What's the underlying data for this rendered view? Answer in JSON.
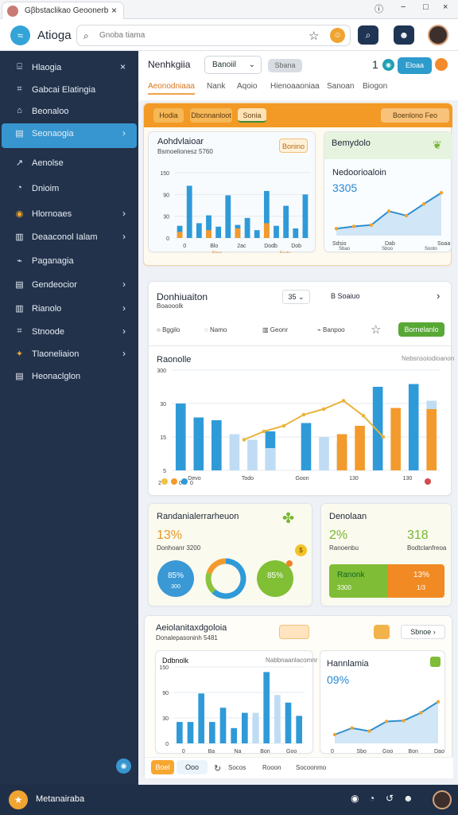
{
  "browser": {
    "tab_title": "Gβbstaclikao Geoonerb",
    "tab_close": "×",
    "controls": [
      "ⓘ",
      "−",
      "□",
      "×"
    ]
  },
  "app": {
    "title": "Atioga",
    "search_placeholder": "Gnoba tiama",
    "right_icons": {
      "star": "☆",
      "profile": "☻",
      "search": "⌕",
      "emoji": "☺"
    }
  },
  "sidebar": {
    "items": [
      {
        "icon": "⌸",
        "label": "Hlaogia",
        "chevron": "×"
      },
      {
        "icon": "⌗",
        "label": "Gabcai Elatingia",
        "chevron": ""
      },
      {
        "icon": "⌂",
        "label": "Beonaloo",
        "chevron": ""
      },
      {
        "icon": "▤",
        "label": "Seonaogia",
        "chevron": "›",
        "active": true
      },
      {
        "icon": "↗",
        "label": "Aenolse",
        "chevron": ""
      },
      {
        "icon": "◔",
        "label": "Dnioim",
        "chevron": ""
      },
      {
        "icon": "◉",
        "label": "Hlornoaes",
        "chevron": "›"
      },
      {
        "icon": "▥",
        "label": "Deaaconol Ialam",
        "chevron": "›"
      },
      {
        "icon": "⌁",
        "label": "Paganagia",
        "chevron": ""
      },
      {
        "icon": "▤",
        "label": "Gendeocior",
        "chevron": "›"
      },
      {
        "icon": "▥",
        "label": "Rianolo",
        "chevron": "›"
      },
      {
        "icon": "⌗",
        "label": "Stnoode",
        "chevron": "›"
      },
      {
        "icon": "✦",
        "label": "Tlaoneliaion",
        "chevron": "›"
      },
      {
        "icon": "▤",
        "label": "Heonaclglon",
        "chevron": ""
      }
    ],
    "footer_fab": "◉"
  },
  "header": {
    "title": "Nenhkgiia",
    "select": "Banoiil",
    "btn_muted": "Sbana",
    "number": "1",
    "btn_primary": "Eloaa",
    "tabs": [
      "Aeonodniaaa",
      "Nank",
      "Aqoio",
      "Hienoaaoniaa",
      "Sanoan",
      "Biogon"
    ]
  },
  "filter_row": {
    "items": [
      "Hodia",
      "Dbcnnanloot",
      "Sonia"
    ],
    "action": "Boenlono Feo"
  },
  "panel1": {
    "title": "Aohdvlaioar",
    "subtitle": "Bsmoelionesz 5760",
    "badge": "Bonino",
    "ytick": [
      "150",
      "90",
      "30",
      "0"
    ],
    "xticks": [
      "0",
      "Blo",
      "2ac",
      "Dodb",
      "Dob"
    ],
    "xsub": [
      "Emo",
      "Eode"
    ]
  },
  "panel2": {
    "title": "Bemydolo",
    "subtitle": "Nedoorioaloin",
    "value": "3305",
    "xticks": [
      "Sdsio",
      "Dab",
      "Soaa"
    ],
    "xsub": [
      "Sbao",
      "Sboo",
      "Sooto"
    ]
  },
  "section": {
    "title": "Donhiuaiton",
    "subtitle": "Boaooolk",
    "select": "35",
    "aside": "Soaiuo",
    "arrow": "›",
    "actions": [
      "Bggilo",
      "Namo",
      "Geonr",
      "Banpoo"
    ],
    "button": "Bornelanlo"
  },
  "chart_main": {
    "title": "Raonolle",
    "right": "Nebsnsoiodioanon",
    "yticks": [
      "300",
      "30",
      "15",
      "5"
    ],
    "xticks": [
      "Devo",
      "Todo",
      "Goon",
      "130",
      "130"
    ],
    "footer": [
      "2",
      "0",
      "0"
    ]
  },
  "summary_left": {
    "title": "Randanialerrarheuon",
    "stat": "13%",
    "stat_label": "Donhoanr 3200",
    "rings": [
      "85%",
      "85%"
    ],
    "ring_labels": [
      "300",
      ""
    ]
  },
  "summary_right": {
    "title": "Denolaan",
    "stat1": "2%",
    "stat2": "318",
    "label1": "Ranoenbu",
    "label2": "Bodtclanfreoa",
    "bar_left": "Ranonk",
    "bar_left_sub": "3300",
    "bar_right": "13%",
    "bar_right_sub": "1/3"
  },
  "bottom_card": {
    "title": "Aeiolanitaxdgoloia",
    "subtitle": "Donalepasoninh 5481",
    "btn": "Sbnoe",
    "chart_left_title": "Ddbnolk",
    "chart_left_right": "Nabbnaanlacomnr",
    "chart_right_title": "Hannlamia",
    "chart_right_value": "09%",
    "left_ticks": [
      "0",
      "Ba",
      "Na",
      "Bon",
      "Goo"
    ],
    "right_ticks": [
      "0",
      "Sbo",
      "Goo",
      "Bon",
      "Dao"
    ],
    "footer_buttons": [
      "Boel",
      "Ooo",
      "Socos",
      "Rooon",
      "Socoonmo"
    ]
  },
  "bottom": {
    "title": "Metanairaba",
    "icons": [
      "◉",
      "◔",
      "↺",
      "☻"
    ]
  },
  "chart_data": [
    {
      "type": "bar",
      "title": "Aohdvlaioar",
      "categories": [
        "1",
        "2",
        "3",
        "4",
        "5",
        "6",
        "7",
        "8",
        "9",
        "10",
        "11",
        "12",
        "13",
        "14"
      ],
      "series": [
        {
          "name": "blue",
          "values": [
            28,
            120,
            34,
            52,
            26,
            98,
            30,
            46,
            18,
            108,
            28,
            74,
            22,
            100
          ]
        },
        {
          "name": "orange",
          "values": [
            14,
            0,
            0,
            18,
            0,
            0,
            22,
            0,
            0,
            34,
            0,
            0,
            0,
            0
          ]
        }
      ],
      "ylim": [
        0,
        150
      ]
    },
    {
      "type": "area",
      "title": "Nedoorioaloin",
      "x": [
        "1",
        "2",
        "3",
        "4",
        "5",
        "6",
        "7"
      ],
      "series": [
        {
          "name": "line",
          "values": [
            34,
            45,
            52,
            120,
            98,
            155,
            210
          ]
        }
      ],
      "ylim": [
        0,
        250
      ]
    },
    {
      "type": "bar",
      "title": "Raonolle",
      "categories": [
        "1",
        "2",
        "3",
        "4",
        "5",
        "6",
        "7",
        "8",
        "9",
        "10",
        "11",
        "12",
        "13",
        "14",
        "15"
      ],
      "series": [
        {
          "name": "blue",
          "values": [
            120,
            95,
            90,
            0,
            0,
            70,
            0,
            85,
            0,
            50,
            0,
            150,
            0,
            155,
            0
          ]
        },
        {
          "name": "light",
          "values": [
            0,
            0,
            0,
            65,
            55,
            40,
            0,
            0,
            60,
            0,
            0,
            0,
            0,
            0,
            125
          ]
        },
        {
          "name": "orange",
          "values": [
            0,
            0,
            0,
            0,
            0,
            0,
            0,
            0,
            0,
            65,
            80,
            0,
            112,
            0,
            110
          ]
        }
      ],
      "ylim": [
        0,
        180
      ]
    },
    {
      "type": "line",
      "title": "Raonolle trend",
      "x": [
        "1",
        "2",
        "3",
        "4",
        "5",
        "6",
        "7",
        "8"
      ],
      "series": [
        {
          "name": "trend",
          "values": [
            55,
            70,
            80,
            100,
            110,
            125,
            98,
            60
          ]
        }
      ],
      "ylim": [
        0,
        180
      ]
    },
    {
      "type": "pie",
      "title": "Randanialerrarheuon",
      "categories": [
        "Blue",
        "Orange",
        "Green"
      ],
      "values": [
        85,
        10,
        5
      ]
    },
    {
      "type": "bar",
      "title": "Ddbnolk",
      "categories": [
        "1",
        "2",
        "3",
        "4",
        "5",
        "6",
        "7",
        "8",
        "9",
        "10",
        "11",
        "12"
      ],
      "series": [
        {
          "name": "blue",
          "values": [
            42,
            42,
            98,
            42,
            70,
            30,
            60,
            50,
            140,
            20,
            80,
            54
          ]
        },
        {
          "name": "light",
          "values": [
            0,
            0,
            0,
            0,
            0,
            0,
            0,
            60,
            0,
            95,
            0,
            0
          ]
        }
      ],
      "ylim": [
        0,
        150
      ]
    },
    {
      "type": "area",
      "title": "Hannlamia",
      "x": [
        "1",
        "2",
        "3",
        "4",
        "5",
        "6",
        "7"
      ],
      "series": [
        {
          "name": "line",
          "values": [
            20,
            35,
            28,
            50,
            52,
            70,
            95
          ]
        }
      ],
      "ylim": [
        0,
        120
      ]
    }
  ]
}
